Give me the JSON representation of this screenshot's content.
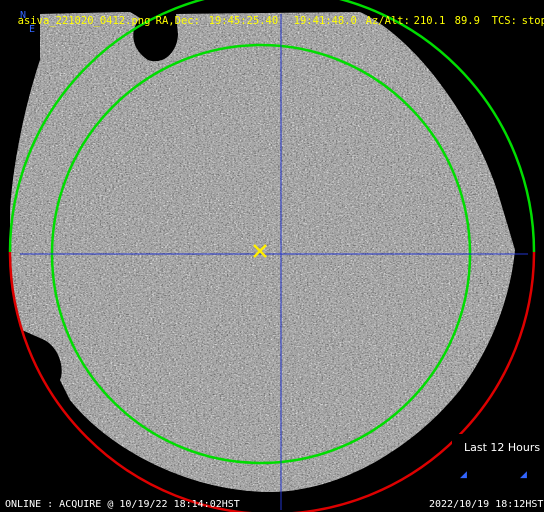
{
  "header": {
    "filename": "asiva_221020_0412.png",
    "radec_label": "RA,Dec:",
    "ra": "19:45:25.40",
    "dec": "19:41:48.0",
    "azalt_label": "Az/Alt:",
    "az": "210.1",
    "alt": "89.9",
    "tcs_label": "TCS:",
    "tcs": "stop"
  },
  "compass": {
    "north": "N",
    "east": "E"
  },
  "legend": {
    "label": "Last 12 Hours"
  },
  "footer": {
    "status": "ONLINE : ACQUIRE @ 10/19/22 18:14:02HST",
    "datetime": "2022/10/19 18:12HST"
  },
  "colors": {
    "header_text": "#ffff00",
    "compass": "#3366ff",
    "crosshair": "#2233cc",
    "inner_circle": "#00dd00",
    "outer_circle_upper": "#00dd00",
    "outer_circle_lower": "#dd0000",
    "target_marker": "#ffee00",
    "background": "#000000"
  },
  "icons": {
    "target": "x-marker-icon",
    "compass": "compass-icon"
  }
}
